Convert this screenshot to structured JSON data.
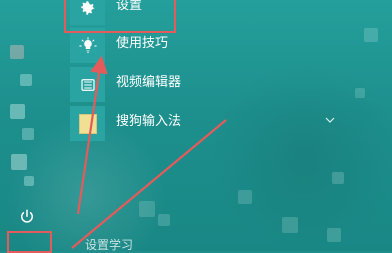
{
  "menu": {
    "items": [
      {
        "label": "设置",
        "icon": "gear-icon"
      },
      {
        "label": "使用技巧",
        "icon": "lightbulb-icon"
      },
      {
        "label": "视频编辑器",
        "icon": "video-editor-icon"
      },
      {
        "label": "搜狗输入法",
        "icon": "sogou-input-icon"
      }
    ],
    "bottom_partial_label": "设置学习"
  },
  "colors": {
    "background": "#1f8f8d",
    "tile": "#2aa4a2",
    "highlight": "#e45b5b",
    "text": "#ffffff"
  }
}
